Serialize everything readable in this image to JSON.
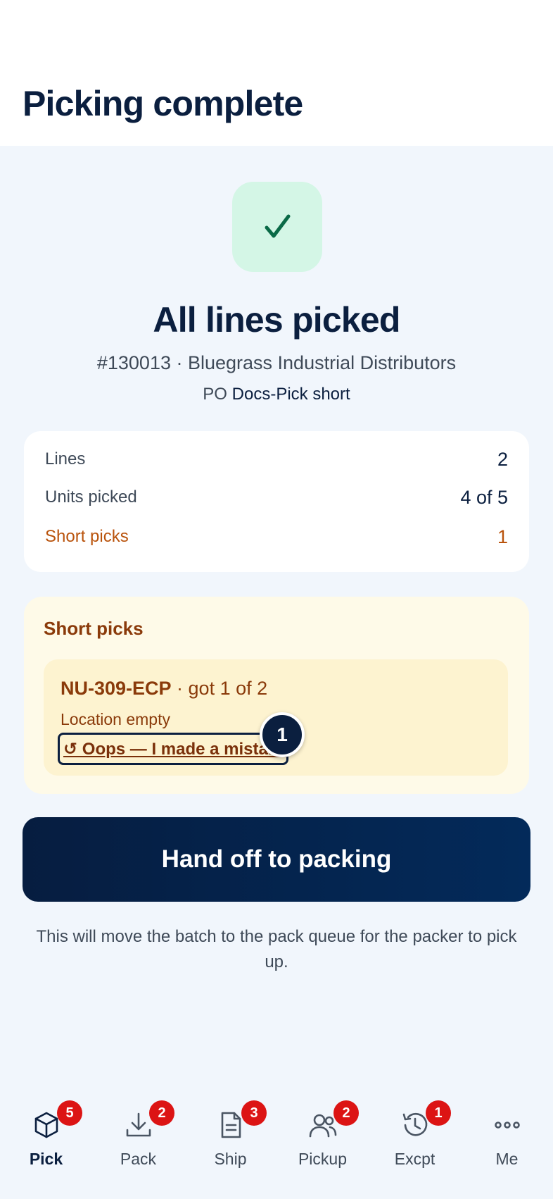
{
  "header": {
    "title": "Picking complete"
  },
  "hero": {
    "icon": "checkmark-icon",
    "title": "All lines picked",
    "order_line": "#130013 · Bluegrass Industrial Distributors",
    "po_label": "PO",
    "po_value": "Docs-Pick short"
  },
  "summary": {
    "rows": [
      {
        "label": "Lines",
        "value": "2"
      },
      {
        "label": "Units picked",
        "value": "4 of 5"
      },
      {
        "label": "Short picks",
        "value": "1"
      }
    ]
  },
  "short_picks": {
    "title": "Short picks",
    "items": [
      {
        "sku": "NU-309-ECP",
        "detail": " · got 1 of 2",
        "reason": "Location empty",
        "undo_label": "↺ Oops — I made a mistake"
      }
    ]
  },
  "step_badge": "1",
  "primary_action": {
    "label": "Hand off to packing"
  },
  "helper_text": "This will move the batch to the pack queue for the packer to pick up.",
  "tabbar": {
    "tabs": [
      {
        "label": "Pick",
        "icon": "box-icon",
        "badge": "5",
        "active": true
      },
      {
        "label": "Pack",
        "icon": "download-icon",
        "badge": "2"
      },
      {
        "label": "Ship",
        "icon": "document-icon",
        "badge": "3"
      },
      {
        "label": "Pickup",
        "icon": "users-icon",
        "badge": "2"
      },
      {
        "label": "Excpt",
        "icon": "history-icon",
        "badge": "1"
      },
      {
        "label": "Me",
        "icon": "more-icon"
      }
    ]
  },
  "colors": {
    "navy": "#0b1f3f",
    "success_bg": "#d4f6e6",
    "success": "#0a6a47",
    "warning_text": "#b9530c",
    "warning_bg": "#fefae8",
    "badge_red": "#dc1414"
  }
}
